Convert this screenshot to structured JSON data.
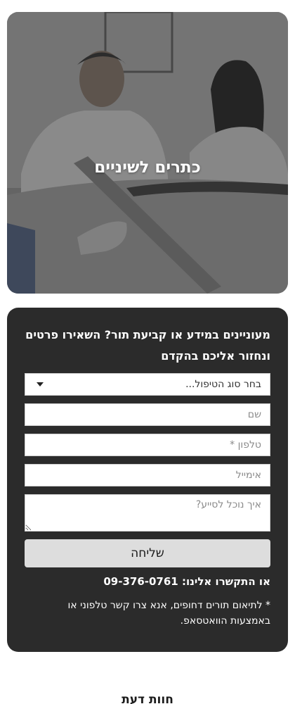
{
  "hero": {
    "title": "כתרים לשיניים"
  },
  "form": {
    "heading": "מעוניינים במידע או קביעת תור? השאירו פרטים ונחזור אליכם בהקדם",
    "treatment_select": {
      "value": "בחר סוג הטיפול..."
    },
    "name_placeholder": "שם",
    "phone_placeholder": "טלפון *",
    "email_placeholder": "אימייל",
    "message_placeholder": "איך נוכל לסייע?",
    "submit_label": "שליחה",
    "contact_prefix": "או התקשרו אלינו:",
    "contact_phone": "09-376-0761",
    "note": "* לתיאום תורים דחופים, אנא צרו קשר טלפוני או באמצעות הוואטסאפ."
  },
  "bottom": {
    "heading": "חוות דעת"
  },
  "colors": {
    "card_background": "#2b2b2b",
    "button_background": "#dddddd",
    "text_light": "#ffffff"
  }
}
